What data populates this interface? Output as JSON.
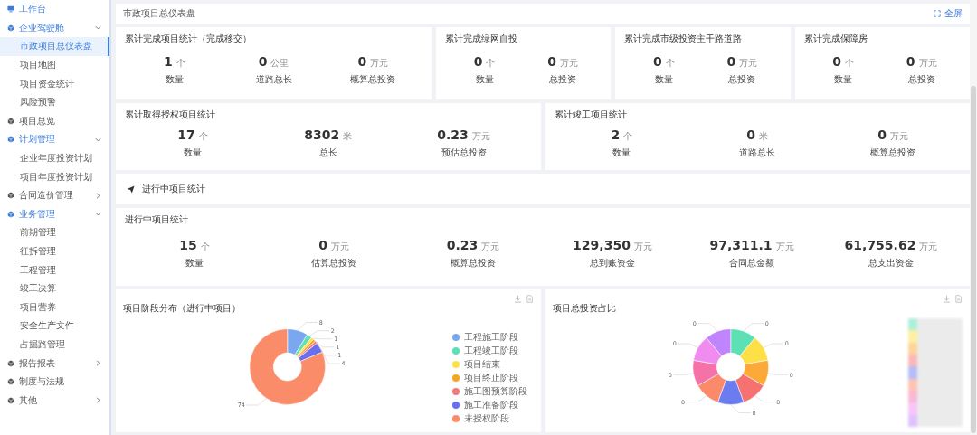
{
  "sidebar": {
    "items": [
      {
        "label": "工作台",
        "kind": "home",
        "selected": false
      },
      {
        "label": "企业驾驶舱",
        "kind": "group",
        "expanded": true,
        "selected": false,
        "children": [
          {
            "label": "市政项目总仪表盘",
            "selected": true
          },
          {
            "label": "项目地图",
            "selected": false
          },
          {
            "label": "项目资金统计",
            "selected": false
          },
          {
            "label": "风险预警",
            "selected": false
          }
        ]
      },
      {
        "label": "项目总览",
        "kind": "page",
        "selected": false
      },
      {
        "label": "计划管理",
        "kind": "group",
        "expanded": true,
        "selected": false,
        "children": [
          {
            "label": "企业年度投资计划",
            "selected": false
          },
          {
            "label": "项目年度投资计划",
            "selected": false
          }
        ]
      },
      {
        "label": "合同造价管理",
        "kind": "group",
        "expanded": false,
        "selected": false
      },
      {
        "label": "业务管理",
        "kind": "group",
        "expanded": true,
        "selected": false,
        "children": [
          {
            "label": "前期管理",
            "selected": false
          },
          {
            "label": "征拆管理",
            "selected": false
          },
          {
            "label": "工程管理",
            "selected": false
          },
          {
            "label": "竣工决算",
            "selected": false
          },
          {
            "label": "项目营养",
            "selected": false
          },
          {
            "label": "安全生产文件",
            "selected": false
          },
          {
            "label": "占掘路管理",
            "selected": false
          }
        ]
      },
      {
        "label": "报告报表",
        "kind": "group",
        "expanded": false,
        "selected": false
      },
      {
        "label": "制度与法规",
        "kind": "page",
        "selected": false
      },
      {
        "label": "其他",
        "kind": "group",
        "expanded": false,
        "selected": false
      }
    ]
  },
  "header": {
    "title": "市政项目总仪表盘",
    "fullscreen": "全屏"
  },
  "row_1": [
    {
      "title": "累计完成项目统计（完成移交）",
      "stats": [
        {
          "value": "1",
          "unit": "个",
          "label": "数量"
        },
        {
          "value": "0",
          "unit": "公里",
          "label": "道路总长"
        },
        {
          "value": "0",
          "unit": "万元",
          "label": "概算总投资"
        }
      ]
    },
    {
      "title": "累计完成绿网自投",
      "stats": [
        {
          "value": "0",
          "unit": "个",
          "label": "数量"
        },
        {
          "value": "0",
          "unit": "万元",
          "label": "总投资"
        }
      ]
    },
    {
      "title": "累计完成市级投资主干路道路",
      "stats": [
        {
          "value": "0",
          "unit": "个",
          "label": "数量"
        },
        {
          "value": "0",
          "unit": "万元",
          "label": "总投资"
        }
      ]
    },
    {
      "title": "累计完成保障房",
      "stats": [
        {
          "value": "0",
          "unit": "个",
          "label": "数量"
        },
        {
          "value": "0",
          "unit": "万元",
          "label": "总投资"
        }
      ]
    }
  ],
  "row_2": [
    {
      "title": "累计取得授权项目统计",
      "stats": [
        {
          "value": "17",
          "unit": "个",
          "label": "数量"
        },
        {
          "value": "8302",
          "unit": "米",
          "label": "总长"
        },
        {
          "value": "0.23",
          "unit": "万元",
          "label": "预估总投资"
        }
      ]
    },
    {
      "title": "累计竣工项目统计",
      "stats": [
        {
          "value": "2",
          "unit": "个",
          "label": "数量"
        },
        {
          "value": "0",
          "unit": "米",
          "label": "道路总长"
        },
        {
          "value": "0",
          "unit": "万元",
          "label": "概算总投资"
        }
      ]
    }
  ],
  "section": {
    "title": "进行中项目统计"
  },
  "in_progress": {
    "title": "进行中项目统计",
    "stats": [
      {
        "value": "15",
        "unit": "个",
        "label": "数量"
      },
      {
        "value": "0",
        "unit": "万元",
        "label": "估算总投资"
      },
      {
        "value": "0.23",
        "unit": "万元",
        "label": "概算总投资"
      },
      {
        "value": "129,350",
        "unit": "万元",
        "label": "总到账资金"
      },
      {
        "value": "97,311.1",
        "unit": "万元",
        "label": "合同总金额"
      },
      {
        "value": "61,755.62",
        "unit": "万元",
        "label": "总支出资金"
      }
    ]
  },
  "charts": [
    {
      "title": "项目阶段分布（进行中项目）",
      "chart_data": {
        "type": "donut",
        "categories": [
          "工程施工阶段",
          "工程竣工阶段",
          "项目结束",
          "项目终止阶段",
          "施工图预算阶段",
          "施工准备阶段",
          "未授权阶段"
        ],
        "values": [
          8,
          2,
          1,
          1,
          1,
          4,
          74
        ],
        "data_labels": true
      }
    },
    {
      "title": "项目总投资占比",
      "slice_labels": [
        "0",
        "0",
        "0",
        "0",
        "0",
        "0",
        "0",
        "0",
        "0"
      ]
    }
  ]
}
